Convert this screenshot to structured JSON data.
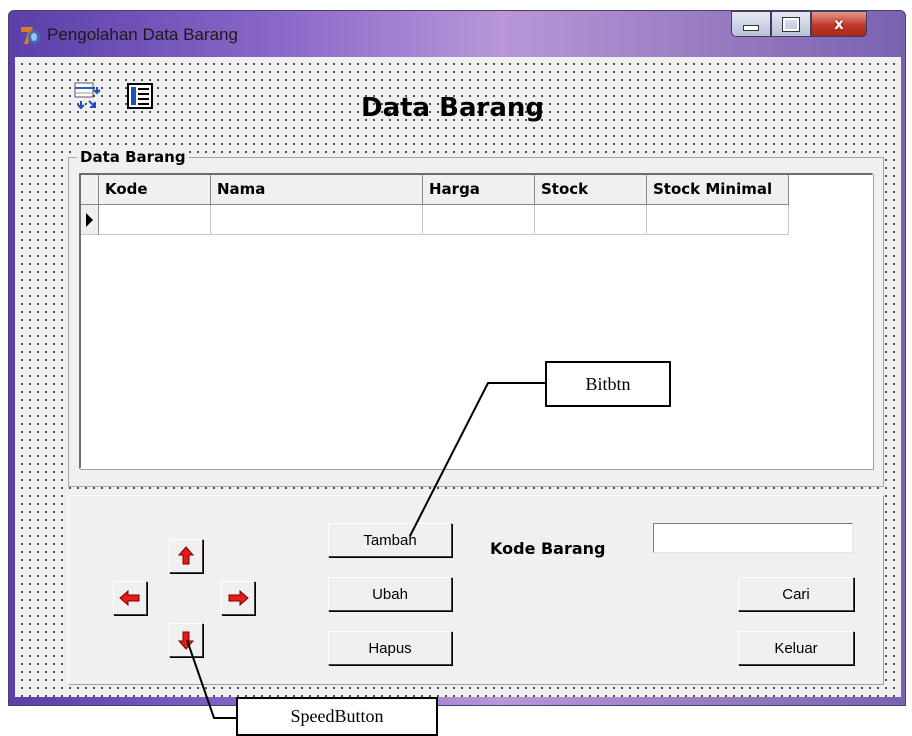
{
  "window": {
    "title": "Pengolahan Data Barang",
    "controls": {
      "minimize": "–",
      "maximize": "□",
      "close": "x"
    }
  },
  "form": {
    "heading": "Data Barang",
    "toolbar_icons": [
      "navigation-icon",
      "table-icon"
    ]
  },
  "group": {
    "caption": "Data Barang",
    "grid": {
      "columns": [
        "Kode",
        "Nama",
        "Harga",
        "Stock",
        "Stock Minimal"
      ],
      "rows": [
        [
          "",
          "",
          "",
          "",
          ""
        ]
      ]
    }
  },
  "panel": {
    "buttons": {
      "tambah": "Tambah",
      "ubah": "Ubah",
      "hapus": "Hapus",
      "cari": "Cari",
      "keluar": "Keluar"
    },
    "kode_label": "Kode Barang",
    "kode_value": ""
  },
  "annotations": {
    "bitbtn": "Bitbtn",
    "speedbutton": "SpeedButton"
  },
  "colors": {
    "arrow": "#e81b1b",
    "titlebar": "#8a68c8",
    "form_bg": "#f0f0f0"
  }
}
